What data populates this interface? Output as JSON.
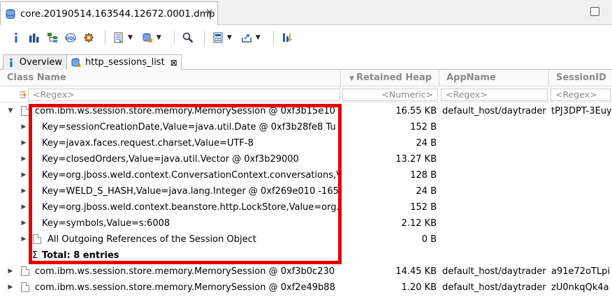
{
  "editor_tab": {
    "title": "core.20190514.163544.12672.0001.dmp",
    "close": "✕"
  },
  "subtabs": [
    {
      "label": "Overview",
      "icon": "info-icon"
    },
    {
      "label": "http_sessions_list",
      "icon": "oql-query-icon",
      "close": "⊠"
    }
  ],
  "columns": {
    "class_name": "Class Name",
    "retained_heap": "Retained Heap",
    "app_name": "AppName",
    "session_id": "SessionID"
  },
  "filters": {
    "class_name": "<Regex>",
    "retained_heap": "<Numeric>",
    "app_name": "<Regex>",
    "session_id": "<Regex>"
  },
  "rows": [
    {
      "label": "com.ibm.ws.session.store.memory.MemorySession @ 0xf3b15e10",
      "heap": "16.55 KB",
      "app": "default_host/daytrader",
      "sid": "tPJ3DPT-3Euy",
      "expanded": true,
      "level": 0
    },
    {
      "label": "Key=sessionCreationDate,Value=java.util.Date @ 0xf3b28fe8  Tu",
      "heap": "152 B",
      "level": 1
    },
    {
      "label": "Key=javax.faces.request.charset,Value=UTF-8",
      "heap": "24 B",
      "level": 1
    },
    {
      "label": "Key=closedOrders,Value=java.util.Vector @ 0xf3b29000",
      "heap": "13.27 KB",
      "level": 1
    },
    {
      "label": "Key=org.jboss.weld.context.ConversationContext.conversations,V",
      "heap": "128 B",
      "level": 1
    },
    {
      "label": "Key=WELD_S_HASH,Value=java.lang.Integer @ 0xf269e010  -165",
      "heap": "24 B",
      "level": 1
    },
    {
      "label": "Key=org.jboss.weld.context.beanstore.http.LockStore,Value=org.",
      "heap": "152 B",
      "level": 1
    },
    {
      "label": "Key=symbols,Value=s:6008",
      "heap": "2.12 KB",
      "level": 1
    },
    {
      "label": "All Outgoing References of the Session Object",
      "heap": "0 B",
      "level": 1
    },
    {
      "label": "Total: 8 entries",
      "heap": "",
      "level": 1,
      "total": true
    },
    {
      "label": "com.ibm.ws.session.store.memory.MemorySession @ 0xf3b0c230",
      "heap": "14.45 KB",
      "app": "default_host/daytrader",
      "sid": "a91e72oTLpi",
      "level": 0
    },
    {
      "label": "com.ibm.ws.session.store.memory.MemorySession @ 0xf2e49b88",
      "heap": "1.20 KB",
      "app": "default_host/daytrader",
      "sid": "zU0nkqQk4a",
      "level": 0
    }
  ],
  "total_symbol": "Σ",
  "colors": {
    "highlight_box": "#e00000"
  }
}
